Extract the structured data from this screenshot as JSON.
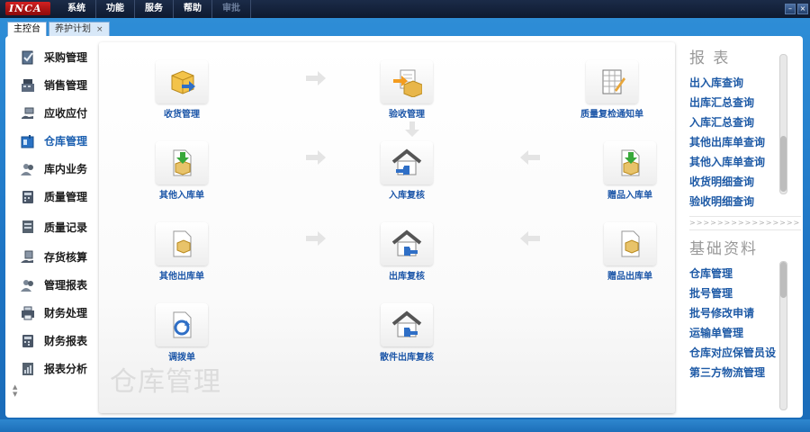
{
  "app": {
    "logo": "INCA"
  },
  "menu": [
    {
      "label": "系统",
      "enabled": true
    },
    {
      "label": "功能",
      "enabled": true
    },
    {
      "label": "服务",
      "enabled": true
    },
    {
      "label": "帮助",
      "enabled": true
    },
    {
      "label": "审批",
      "enabled": false
    }
  ],
  "window_buttons": {
    "minimize": "–",
    "close": "×"
  },
  "tabs": [
    {
      "label": "主控台",
      "active": true
    },
    {
      "label": "养护计划",
      "active": false,
      "close": "×"
    }
  ],
  "sidebar": {
    "items": [
      {
        "label": "采购管理",
        "icon": "clipboard-check-icon"
      },
      {
        "label": "销售管理",
        "icon": "cash-register-icon"
      },
      {
        "label": "应收应付",
        "icon": "money-hand-icon"
      },
      {
        "label": "仓库管理",
        "icon": "warehouse-lock-icon",
        "active": true
      },
      {
        "label": "库内业务",
        "icon": "people-icon"
      },
      {
        "label": "质量管理",
        "icon": "quality-calculator-icon"
      },
      {
        "label": "质量记录",
        "icon": "quality-record-icon"
      },
      {
        "label": "存货核算",
        "icon": "inventory-hand-icon"
      },
      {
        "label": "管理报表",
        "icon": "people-report-icon"
      },
      {
        "label": "财务处理",
        "icon": "finance-printer-icon"
      },
      {
        "label": "财务报表",
        "icon": "finance-calculator-icon"
      },
      {
        "label": "报表分析",
        "icon": "report-analysis-icon"
      }
    ],
    "scroll_up": "▲",
    "scroll_down": "▼"
  },
  "main": {
    "watermark": "仓库管理",
    "flow": [
      {
        "label": "收货管理",
        "icon": "box-arrow-icon"
      },
      {
        "label": "验收管理",
        "icon": "inspection-icon"
      },
      {
        "label": "质量复检通知单",
        "icon": "notice-sheet-icon"
      },
      {
        "label": "其他入库单",
        "icon": "doc-in-icon"
      },
      {
        "label": "入库复核",
        "icon": "house-review-icon"
      },
      {
        "label": "赠品入库单",
        "icon": "gift-in-icon"
      },
      {
        "label": "其他出库单",
        "icon": "doc-out-icon"
      },
      {
        "label": "出库复核",
        "icon": "house-out-icon"
      },
      {
        "label": "赠品出库单",
        "icon": "gift-out-icon"
      },
      {
        "label": "调拨单",
        "icon": "transfer-icon"
      },
      {
        "label": "散件出库复核",
        "icon": "house-parts-icon"
      }
    ]
  },
  "reports": {
    "title": "报  表",
    "links": [
      "出入库查询",
      "出库汇总查询",
      "入库汇总查询",
      "其他出库单查询",
      "其他入库单查询",
      "收货明细查询",
      "验收明细查询"
    ]
  },
  "divider": ">>>>>>>>>>>>>>>>>>>>>>>",
  "basics": {
    "title": "基础资料",
    "links": [
      "仓库管理",
      "批号管理",
      "批号修改申请",
      "运输单管理",
      "仓库对应保管员设",
      "第三方物流管理"
    ]
  },
  "colors": {
    "accent": "#1e5aa6",
    "frame": "#1d74c4",
    "titlebar": "#0e1a30"
  }
}
